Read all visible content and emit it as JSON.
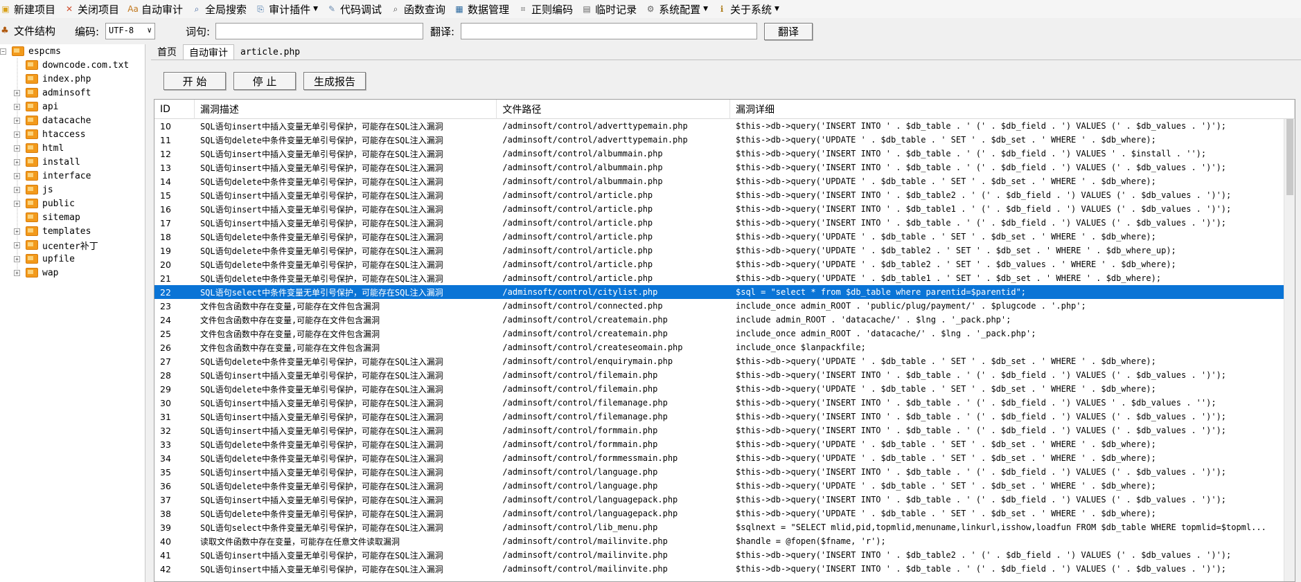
{
  "menubar": {
    "items": [
      {
        "label": "新建项目",
        "icon": "new-project-icon"
      },
      {
        "label": "关闭项目",
        "icon": "close-project-icon"
      },
      {
        "label": "自动审计",
        "icon": "auto-audit-icon"
      },
      {
        "label": "全局搜索",
        "icon": "search-icon"
      },
      {
        "label": "审计插件",
        "icon": "plugin-icon",
        "dropdown": true
      },
      {
        "label": "代码调试",
        "icon": "debug-icon"
      },
      {
        "label": "函数查询",
        "icon": "function-query-icon"
      },
      {
        "label": "数据管理",
        "icon": "data-manage-icon"
      },
      {
        "label": "正则编码",
        "icon": "regex-icon"
      },
      {
        "label": "临时记录",
        "icon": "notes-icon"
      },
      {
        "label": "系统配置",
        "icon": "gear-icon",
        "dropdown": true
      },
      {
        "label": "关于系统",
        "icon": "about-icon",
        "dropdown": true
      }
    ]
  },
  "toolbar": {
    "tree_title": "文件结构",
    "encoding_label": "编码:",
    "encoding_value": "UTF-8",
    "word_label": "词句:",
    "word_value": "",
    "translate_label": "翻译:",
    "translate_value": "",
    "translate_button": "翻译"
  },
  "tree": {
    "root": "espcms",
    "items": [
      {
        "label": "downcode.com.txt",
        "type": "file",
        "expandable": false
      },
      {
        "label": "index.php",
        "type": "file",
        "expandable": false
      },
      {
        "label": "adminsoft",
        "type": "folder",
        "expandable": true
      },
      {
        "label": "api",
        "type": "folder",
        "expandable": true
      },
      {
        "label": "datacache",
        "type": "folder",
        "expandable": true
      },
      {
        "label": "htaccess",
        "type": "folder",
        "expandable": true
      },
      {
        "label": "html",
        "type": "folder",
        "expandable": true
      },
      {
        "label": "install",
        "type": "folder",
        "expandable": true
      },
      {
        "label": "interface",
        "type": "folder",
        "expandable": true
      },
      {
        "label": "js",
        "type": "folder",
        "expandable": true
      },
      {
        "label": "public",
        "type": "folder",
        "expandable": true
      },
      {
        "label": "sitemap",
        "type": "folder",
        "expandable": false
      },
      {
        "label": "templates",
        "type": "folder",
        "expandable": true
      },
      {
        "label": "ucenter补丁",
        "type": "folder",
        "expandable": true
      },
      {
        "label": "upfile",
        "type": "folder",
        "expandable": true
      },
      {
        "label": "wap",
        "type": "folder",
        "expandable": true
      }
    ]
  },
  "tabs": [
    {
      "label": "首页",
      "active": false
    },
    {
      "label": "自动审计",
      "active": true
    },
    {
      "label": "article.php",
      "active": false
    }
  ],
  "actions": {
    "start": "开 始",
    "stop": "停 止",
    "report": "生成报告"
  },
  "table": {
    "columns": [
      "ID",
      "漏洞描述",
      "文件路径",
      "漏洞详细"
    ],
    "selected_id": "22",
    "rows": [
      [
        "10",
        "SQL语句insert中插入变量无单引号保护，可能存在SQL注入漏洞",
        "/adminsoft/control/adverttypemain.php",
        "$this->db->query('INSERT INTO ' . $db_table . ' (' . $db_field . ') VALUES (' . $db_values . ')');"
      ],
      [
        "11",
        "SQL语句delete中条件变量无单引号保护，可能存在SQL注入漏洞",
        "/adminsoft/control/adverttypemain.php",
        "$this->db->query('UPDATE ' . $db_table . ' SET ' . $db_set . ' WHERE ' . $db_where);"
      ],
      [
        "12",
        "SQL语句insert中插入变量无单引号保护，可能存在SQL注入漏洞",
        "/adminsoft/control/albummain.php",
        "$this->db->query('INSERT INTO ' . $db_table . ' (' . $db_field . ') VALUES ' . $install . '');"
      ],
      [
        "13",
        "SQL语句insert中插入变量无单引号保护，可能存在SQL注入漏洞",
        "/adminsoft/control/albummain.php",
        "$this->db->query('INSERT INTO ' . $db_table . ' (' . $db_field . ') VALUES (' . $db_values . ')');"
      ],
      [
        "14",
        "SQL语句delete中条件变量无单引号保护，可能存在SQL注入漏洞",
        "/adminsoft/control/albummain.php",
        "$this->db->query('UPDATE ' . $db_table . ' SET ' . $db_set . ' WHERE ' . $db_where);"
      ],
      [
        "15",
        "SQL语句insert中插入变量无单引号保护，可能存在SQL注入漏洞",
        "/adminsoft/control/article.php",
        "$this->db->query('INSERT INTO ' . $db_table2 . ' (' . $db_field . ') VALUES (' . $db_values . ')');"
      ],
      [
        "16",
        "SQL语句insert中插入变量无单引号保护，可能存在SQL注入漏洞",
        "/adminsoft/control/article.php",
        "$this->db->query('INSERT INTO ' . $db_table1 . ' (' . $db_field . ') VALUES (' . $db_values . ')');"
      ],
      [
        "17",
        "SQL语句insert中插入变量无单引号保护，可能存在SQL注入漏洞",
        "/adminsoft/control/article.php",
        "$this->db->query('INSERT INTO ' . $db_table . ' (' . $db_field . ') VALUES (' . $db_values . ')');"
      ],
      [
        "18",
        "SQL语句delete中条件变量无单引号保护，可能存在SQL注入漏洞",
        "/adminsoft/control/article.php",
        "$this->db->query('UPDATE ' . $db_table . ' SET ' . $db_set . ' WHERE ' . $db_where);"
      ],
      [
        "19",
        "SQL语句delete中条件变量无单引号保护，可能存在SQL注入漏洞",
        "/adminsoft/control/article.php",
        "$this->db->query('UPDATE ' . $db_table2 . ' SET ' . $db_set . ' WHERE ' . $db_where_up);"
      ],
      [
        "20",
        "SQL语句delete中条件变量无单引号保护，可能存在SQL注入漏洞",
        "/adminsoft/control/article.php",
        "$this->db->query('UPDATE ' . $db_table2 . ' SET ' . $db_values . ' WHERE ' . $db_where);"
      ],
      [
        "21",
        "SQL语句delete中条件变量无单引号保护，可能存在SQL注入漏洞",
        "/adminsoft/control/article.php",
        "$this->db->query('UPDATE ' . $db_table1 . ' SET ' . $db_set . ' WHERE ' . $db_where);"
      ],
      [
        "22",
        "SQL语句select中条件变量无单引号保护，可能存在SQL注入漏洞",
        "/adminsoft/control/citylist.php",
        "$sql = \"select * from $db_table where parentid=$parentid\";"
      ],
      [
        "23",
        "文件包含函数中存在变量,可能存在文件包含漏洞",
        "/adminsoft/control/connected.php",
        "include_once admin_ROOT . 'public/plug/payment/' . $plugcode . '.php';"
      ],
      [
        "24",
        "文件包含函数中存在变量,可能存在文件包含漏洞",
        "/adminsoft/control/createmain.php",
        "include admin_ROOT . 'datacache/' . $lng . '_pack.php';"
      ],
      [
        "25",
        "文件包含函数中存在变量,可能存在文件包含漏洞",
        "/adminsoft/control/createmain.php",
        "include_once admin_ROOT . 'datacache/' . $lng . '_pack.php';"
      ],
      [
        "26",
        "文件包含函数中存在变量,可能存在文件包含漏洞",
        "/adminsoft/control/createseomain.php",
        "include_once $lanpackfile;"
      ],
      [
        "27",
        "SQL语句delete中条件变量无单引号保护，可能存在SQL注入漏洞",
        "/adminsoft/control/enquirymain.php",
        "$this->db->query('UPDATE ' . $db_table . ' SET ' . $db_set . ' WHERE ' . $db_where);"
      ],
      [
        "28",
        "SQL语句insert中插入变量无单引号保护，可能存在SQL注入漏洞",
        "/adminsoft/control/filemain.php",
        "$this->db->query('INSERT INTO ' . $db_table . ' (' . $db_field . ') VALUES (' . $db_values . ')');"
      ],
      [
        "29",
        "SQL语句delete中条件变量无单引号保护，可能存在SQL注入漏洞",
        "/adminsoft/control/filemain.php",
        "$this->db->query('UPDATE ' . $db_table . ' SET ' . $db_set . ' WHERE ' . $db_where);"
      ],
      [
        "30",
        "SQL语句insert中插入变量无单引号保护，可能存在SQL注入漏洞",
        "/adminsoft/control/filemanage.php",
        "$this->db->query('INSERT INTO ' . $db_table . ' (' . $db_field . ') VALUES ' . $db_values . '');"
      ],
      [
        "31",
        "SQL语句insert中插入变量无单引号保护，可能存在SQL注入漏洞",
        "/adminsoft/control/filemanage.php",
        "$this->db->query('INSERT INTO ' . $db_table . ' (' . $db_field . ') VALUES (' . $db_values . ')');"
      ],
      [
        "32",
        "SQL语句insert中插入变量无单引号保护，可能存在SQL注入漏洞",
        "/adminsoft/control/formmain.php",
        "$this->db->query('INSERT INTO ' . $db_table . ' (' . $db_field . ') VALUES (' . $db_values . ')');"
      ],
      [
        "33",
        "SQL语句delete中条件变量无单引号保护，可能存在SQL注入漏洞",
        "/adminsoft/control/formmain.php",
        "$this->db->query('UPDATE ' . $db_table . ' SET ' . $db_set . ' WHERE ' . $db_where);"
      ],
      [
        "34",
        "SQL语句delete中条件变量无单引号保护，可能存在SQL注入漏洞",
        "/adminsoft/control/formmessmain.php",
        "$this->db->query('UPDATE ' . $db_table . ' SET ' . $db_set . ' WHERE ' . $db_where);"
      ],
      [
        "35",
        "SQL语句insert中插入变量无单引号保护，可能存在SQL注入漏洞",
        "/adminsoft/control/language.php",
        "$this->db->query('INSERT INTO ' . $db_table . ' (' . $db_field . ') VALUES (' . $db_values . ')');"
      ],
      [
        "36",
        "SQL语句delete中条件变量无单引号保护，可能存在SQL注入漏洞",
        "/adminsoft/control/language.php",
        "$this->db->query('UPDATE ' . $db_table . ' SET ' . $db_set . ' WHERE ' . $db_where);"
      ],
      [
        "37",
        "SQL语句insert中插入变量无单引号保护，可能存在SQL注入漏洞",
        "/adminsoft/control/languagepack.php",
        "$this->db->query('INSERT INTO ' . $db_table . ' (' . $db_field . ') VALUES (' . $db_values . ')');"
      ],
      [
        "38",
        "SQL语句delete中条件变量无单引号保护，可能存在SQL注入漏洞",
        "/adminsoft/control/languagepack.php",
        "$this->db->query('UPDATE ' . $db_table . ' SET ' . $db_set . ' WHERE ' . $db_where);"
      ],
      [
        "39",
        "SQL语句select中条件变量无单引号保护，可能存在SQL注入漏洞",
        "/adminsoft/control/lib_menu.php",
        "$sqlnext = \"SELECT mlid,pid,topmlid,menuname,linkurl,isshow,loadfun FROM $db_table WHERE topmlid=$topml..."
      ],
      [
        "40",
        "读取文件函数中存在变量，可能存在任意文件读取漏洞",
        "/adminsoft/control/mailinvite.php",
        "$handle = @fopen($fname, 'r');"
      ],
      [
        "41",
        "SQL语句insert中插入变量无单引号保护，可能存在SQL注入漏洞",
        "/adminsoft/control/mailinvite.php",
        "$this->db->query('INSERT INTO ' . $db_table2 . ' (' . $db_field . ') VALUES (' . $db_values . ')');"
      ],
      [
        "42",
        "SQL语句insert中插入变量无单引号保护，可能存在SQL注入漏洞",
        "/adminsoft/control/mailinvite.php",
        "$this->db->query('INSERT INTO ' . $db_table . ' (' . $db_field . ') VALUES (' . $db_values . ')');"
      ]
    ]
  },
  "colors": {
    "selection": "#0a74d6",
    "folder": "#f29a1c"
  }
}
